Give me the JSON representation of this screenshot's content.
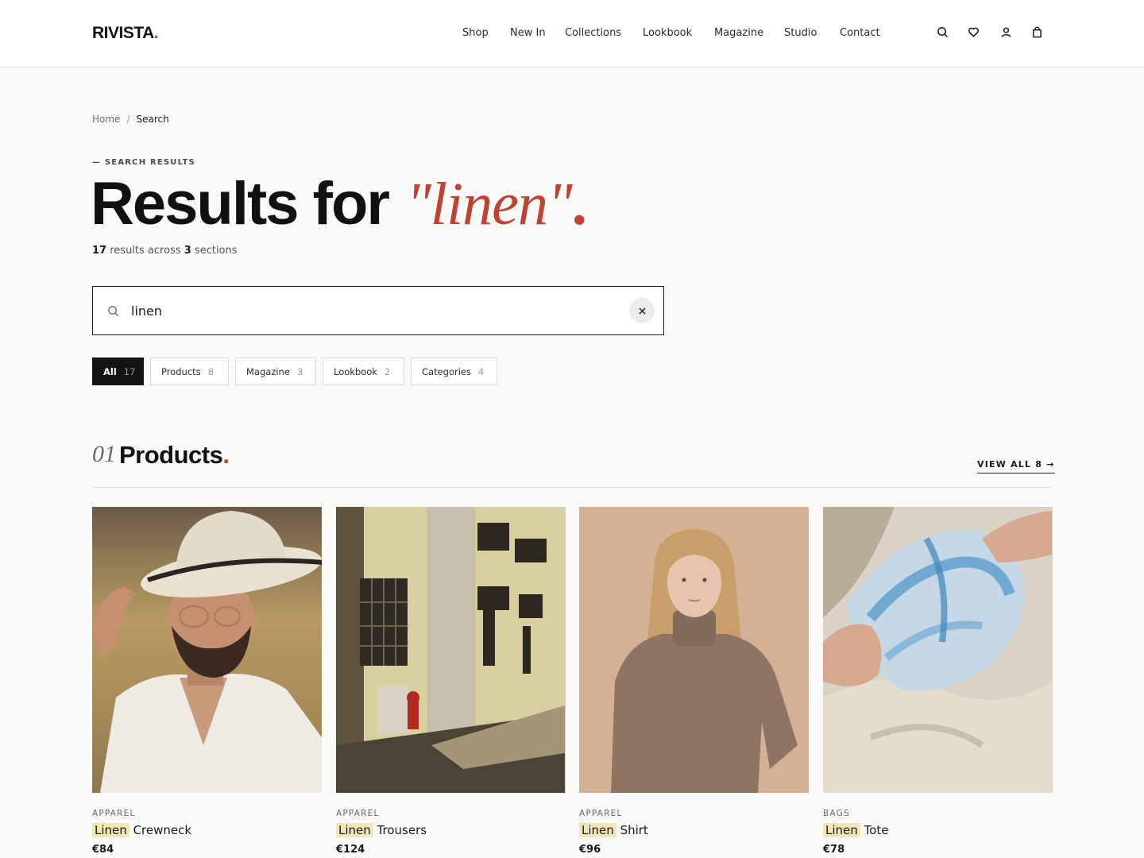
{
  "header": {
    "logo": "RIVISTA",
    "logo_dot": ".",
    "nav": [
      "Shop",
      "New In",
      "Collections",
      "Lookbook",
      "Magazine",
      "Studio",
      "Contact"
    ],
    "icons": [
      "search-icon",
      "heart-icon",
      "user-icon",
      "bag-icon"
    ]
  },
  "breadcrumb": {
    "home": "Home",
    "separator": "/",
    "current": "Search"
  },
  "hero": {
    "eyebrow": "— SEARCH RESULTS",
    "title": "Results for",
    "query": "\"linen\"",
    "title_dot": ".",
    "result_count": "17",
    "results_text": "results across",
    "section_count": "3",
    "sections_text": "sections"
  },
  "search": {
    "value": "linen",
    "placeholder": ""
  },
  "filters": [
    {
      "label": "All",
      "count": "17",
      "active": true
    },
    {
      "label": "Products",
      "count": "8",
      "active": false
    },
    {
      "label": "Magazine",
      "count": "3",
      "active": false
    },
    {
      "label": "Lookbook",
      "count": "2",
      "active": false
    },
    {
      "label": "Categories",
      "count": "4",
      "active": false
    }
  ],
  "products_section": {
    "number": "01",
    "title": "Products",
    "dot": ".",
    "view_all": "VIEW ALL 8 →"
  },
  "products": [
    {
      "category": "APPAREL",
      "highlight": "Linen",
      "name": "Crewneck",
      "price": "€84"
    },
    {
      "category": "APPAREL",
      "highlight": "Linen",
      "name": "Trousers",
      "price": "€124"
    },
    {
      "category": "APPAREL",
      "highlight": "Linen",
      "name": "Shirt",
      "price": "€96"
    },
    {
      "category": "BAGS",
      "highlight": "Linen",
      "name": "Tote",
      "price": "€78"
    }
  ],
  "colors": {
    "accent": "#bf4330",
    "highlight": "#f3e6b5",
    "ink": "#141414"
  }
}
